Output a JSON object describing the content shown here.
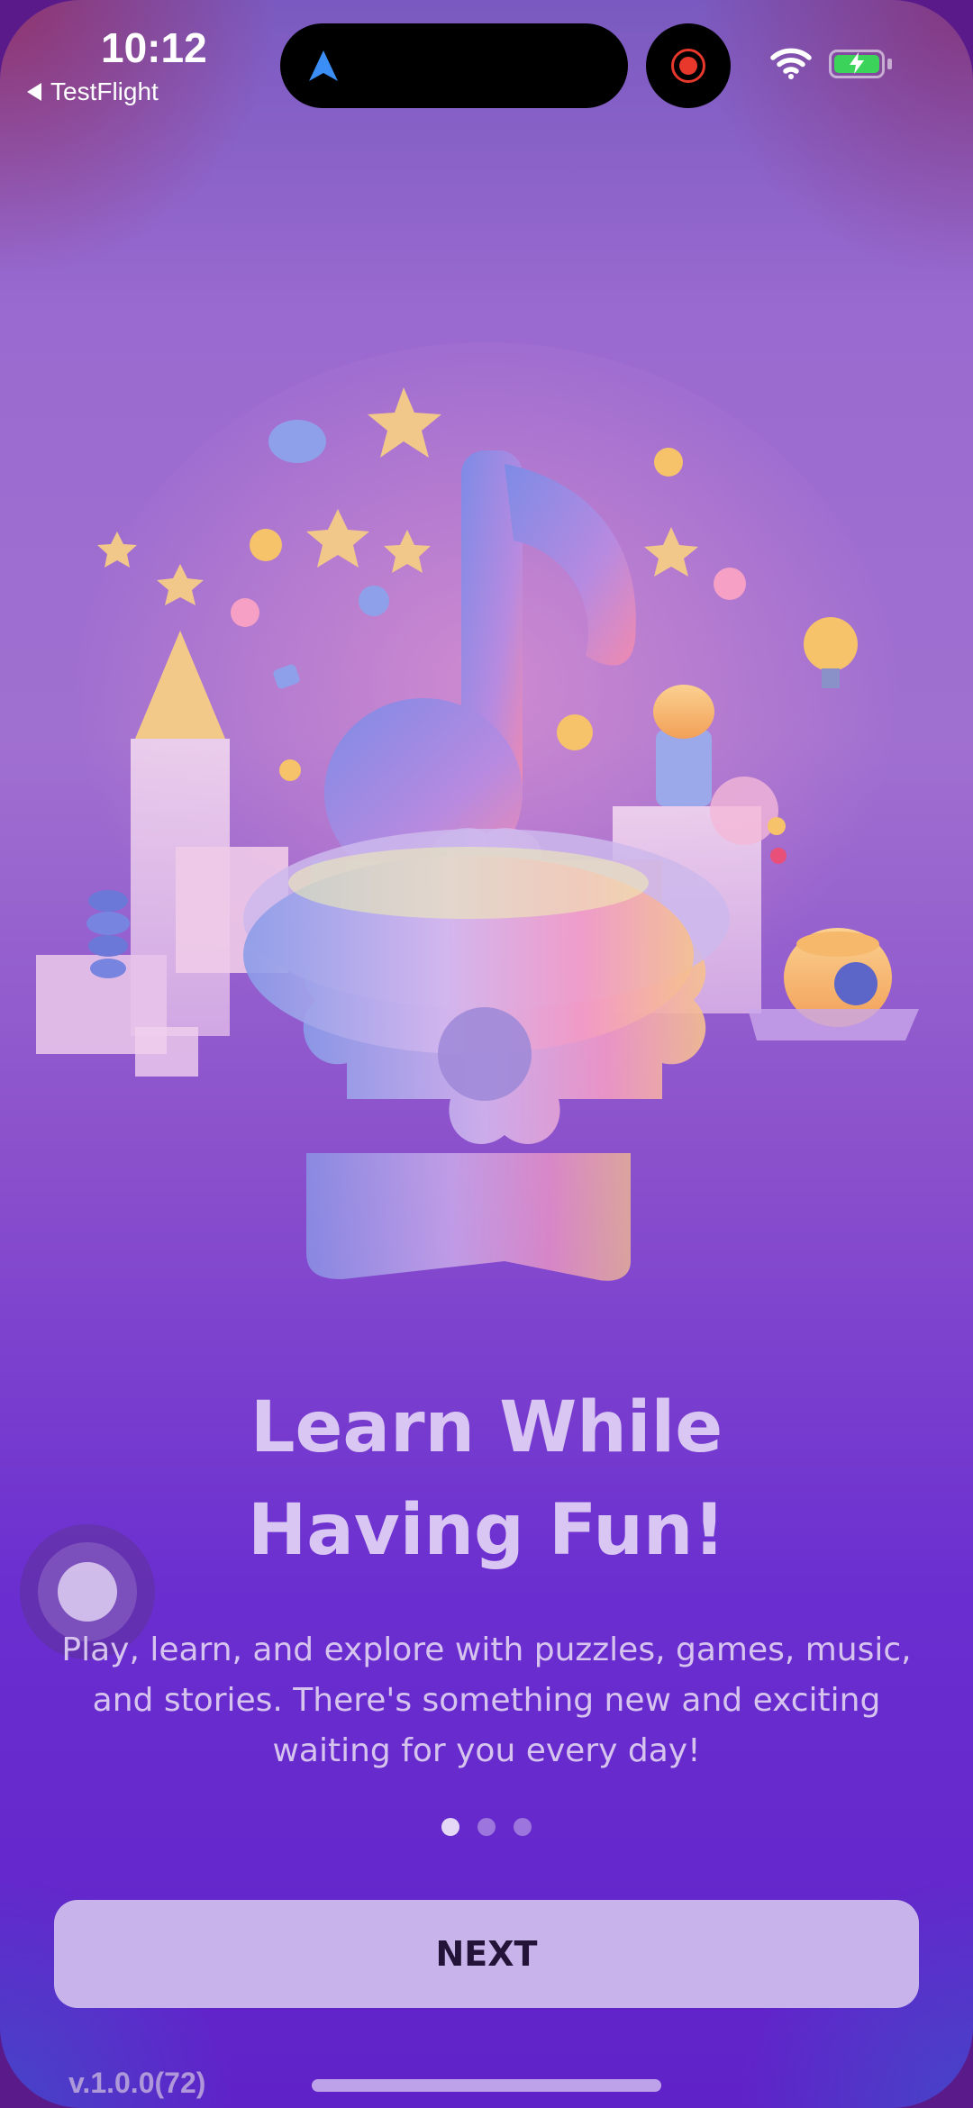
{
  "status_bar": {
    "time": "10:12",
    "back_label": "TestFlight",
    "icons": [
      "navigation-arrow-icon",
      "screen-record-icon",
      "wifi-icon",
      "battery-charging-icon"
    ],
    "battery_color": "#3cd35a",
    "record_color": "#e8372b"
  },
  "onboarding": {
    "title_line1": "Learn While",
    "title_line2": "Having Fun!",
    "description": "Play, learn, and explore with puzzles, games, music, and stories. There's something new and exciting waiting for you every day!",
    "page_count": 3,
    "current_page": 1,
    "next_label": "NEXT"
  },
  "footer": {
    "version": "v.1.0.0(72)"
  },
  "colors": {
    "background_top": "#7a5ac0",
    "background_bottom": "#5f22c8",
    "button_bg": "#c8b3ea",
    "title_color": "#d9c6f2"
  }
}
